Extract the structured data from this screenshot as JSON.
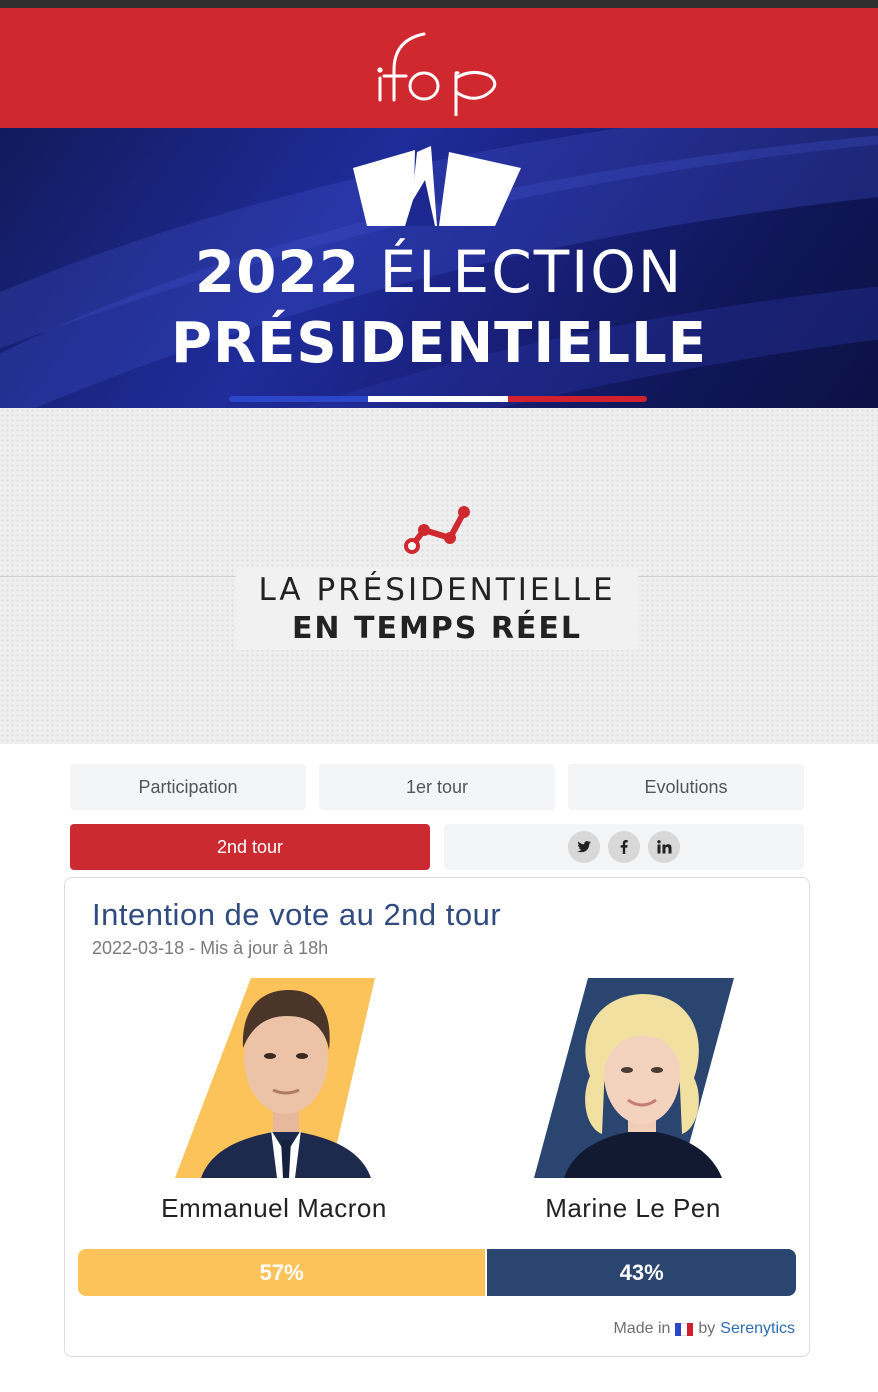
{
  "header": {
    "logo_text": "ifop",
    "brand_color": "#d0282f"
  },
  "banner": {
    "year": "2022",
    "word1": "ÉLECTION",
    "word2": "PRÉSIDENTIELLE",
    "flag_colors": [
      "#2b46c8",
      "#ffffff",
      "#d0202e"
    ]
  },
  "hero": {
    "icon": "line-chart-icon",
    "title_line1": "LA PRÉSIDENTIELLE",
    "title_line2": "EN TEMPS RÉEL"
  },
  "tabs": [
    {
      "label": "Participation",
      "active": false
    },
    {
      "label": "1er tour",
      "active": false
    },
    {
      "label": "Evolutions",
      "active": false
    },
    {
      "label": "2nd tour",
      "active": true
    }
  ],
  "share": {
    "icons": [
      "twitter-icon",
      "facebook-icon",
      "linkedin-icon"
    ]
  },
  "card": {
    "title": "Intention de vote au 2nd tour",
    "subtitle": "2022-03-18 - Mis à jour à 18h",
    "candidates": [
      {
        "name": "Emmanuel Macron",
        "share": 57,
        "label": "57%",
        "color": "#fcc35a"
      },
      {
        "name": "Marine Le Pen",
        "share": 43,
        "label": "43%",
        "color": "#2a4570"
      }
    ],
    "footer_prefix": "Made in",
    "footer_by": "by",
    "footer_link": "Serenytics"
  }
}
